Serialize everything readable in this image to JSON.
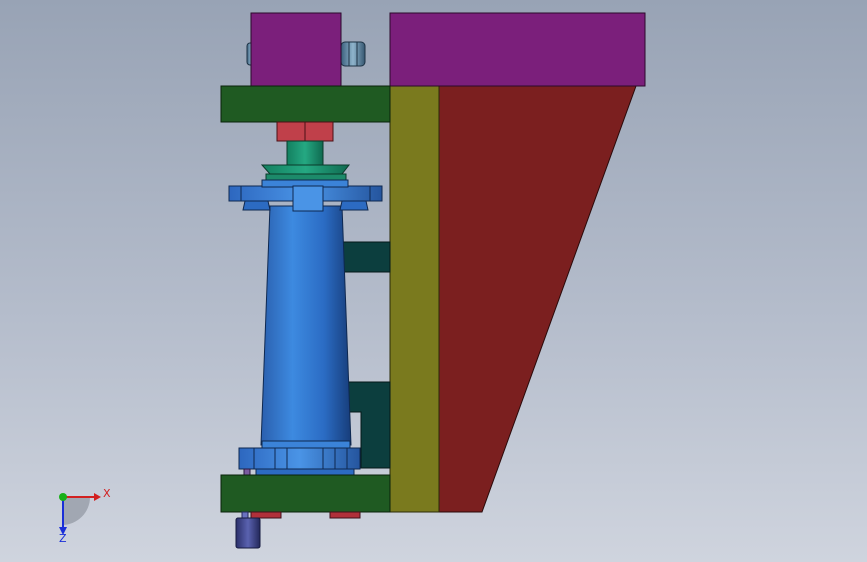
{
  "view": {
    "axes": {
      "x_label": "X",
      "z_label": "Z"
    }
  },
  "colors": {
    "magenta_block": "#7b1f7b",
    "green_plate": "#1f5a22",
    "olive_column": "#7a7a1e",
    "red_gusset": "#7b1f1f",
    "teal_block": "#0c3e3e",
    "blue_shaft": "#2f72c8",
    "green_collar": "#1c8a6a",
    "red_nut": "#c0404a",
    "bolt_gray": "#4c6f88",
    "axis_red": "#d22020",
    "axis_green": "#18b018",
    "axis_blue": "#1a2fd8"
  }
}
